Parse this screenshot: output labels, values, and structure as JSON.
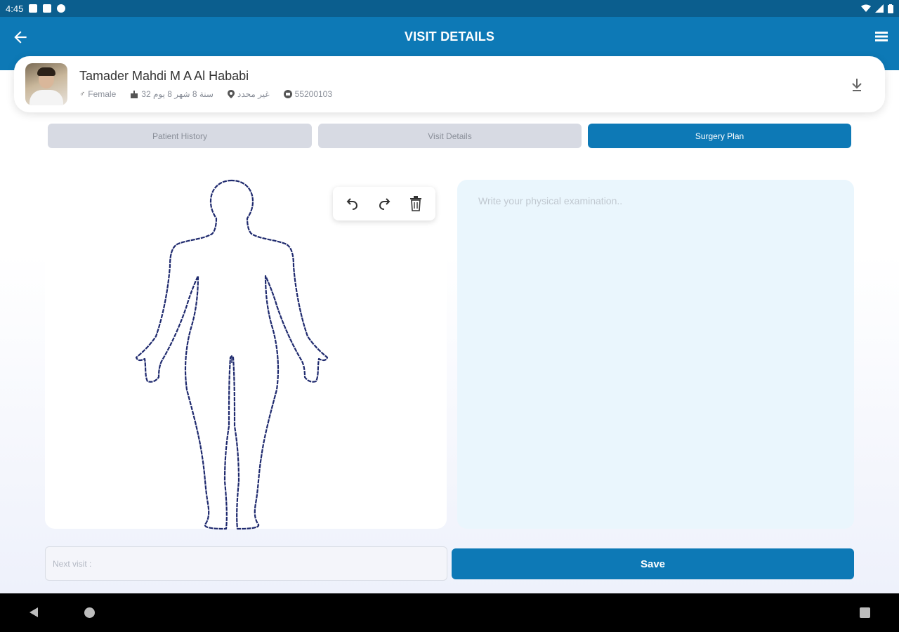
{
  "status_bar": {
    "time": "4:45"
  },
  "app_bar": {
    "title": "VISIT DETAILS"
  },
  "patient": {
    "name": "Tamader Mahdi M A Al Hababi",
    "gender": "Female",
    "age": "32 سنة 8 شهر 8 يوم",
    "location": "غير محدد",
    "id": "55200103"
  },
  "tabs": [
    {
      "label": "Patient History",
      "active": false
    },
    {
      "label": "Visit Details",
      "active": false
    },
    {
      "label": "Surgery Plan",
      "active": true
    }
  ],
  "toolbar": {
    "undo": "undo-icon",
    "redo": "redo-icon",
    "delete": "trash-icon"
  },
  "exam": {
    "placeholder": "Write your physical examination.."
  },
  "next_visit": {
    "placeholder": "Next visit :"
  },
  "save": {
    "label": "Save"
  },
  "colors": {
    "primary": "#0d79b6",
    "status_bar": "#0b5e8e",
    "exam_bg": "#eaf6fd",
    "tab_inactive": "#d7dae3"
  }
}
